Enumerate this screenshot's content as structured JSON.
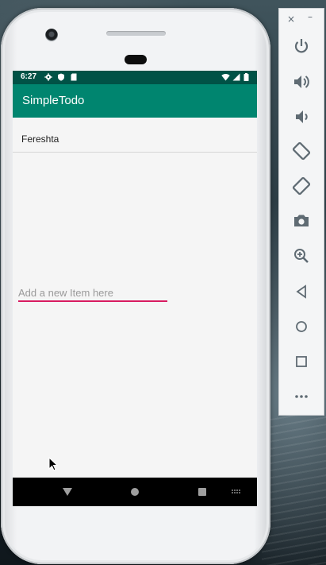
{
  "status_bar": {
    "time": "6:27"
  },
  "app": {
    "title": "SimpleTodo"
  },
  "items": [
    {
      "text": "Fereshta"
    }
  ],
  "new_item": {
    "placeholder": "Add a new Item here",
    "value": ""
  },
  "colors": {
    "status_bar": "#005246",
    "app_bar": "#00856f",
    "input_underline": "#d81b60",
    "screen_bg": "#f5f5f5"
  },
  "navigation": {
    "buttons": [
      "back-icon",
      "home-icon",
      "recents-icon",
      "keyboard-icon"
    ]
  },
  "emulator_toolbar": {
    "close_label": "×",
    "minimize_label": "–",
    "buttons": [
      "power-icon",
      "volume-up-icon",
      "volume-down-icon",
      "rotate-left-icon",
      "rotate-right-icon",
      "camera-icon",
      "zoom-icon",
      "back-icon",
      "home-icon",
      "overview-icon",
      "more-icon"
    ]
  }
}
